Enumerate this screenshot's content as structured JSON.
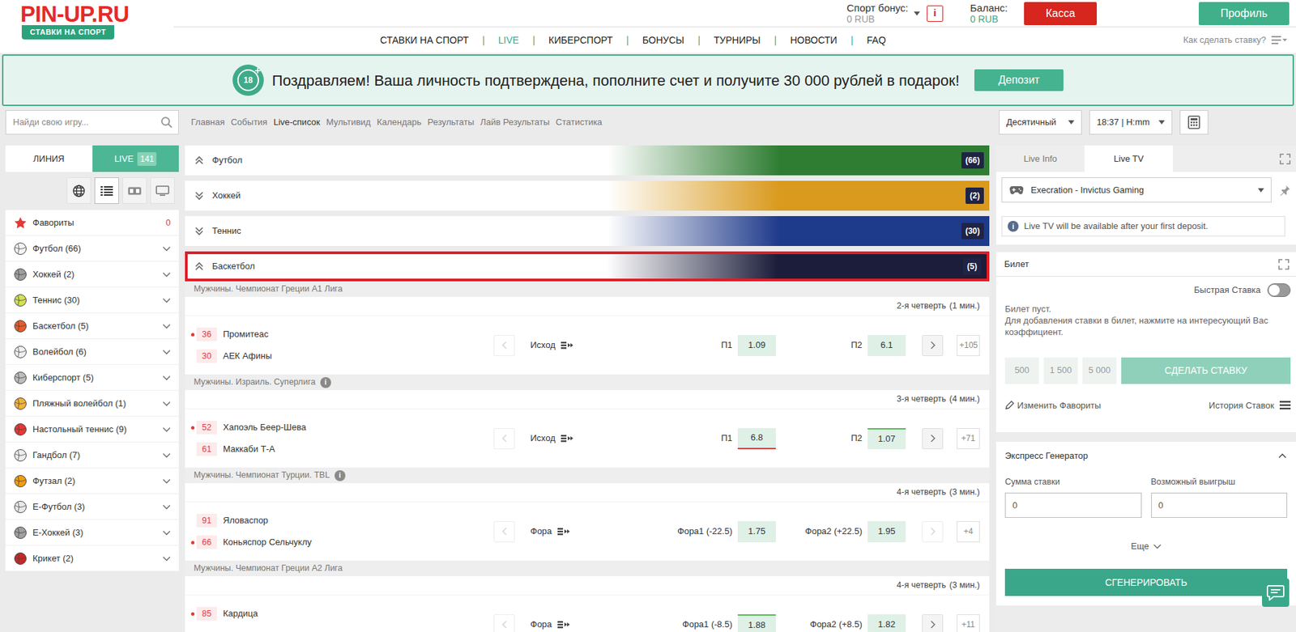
{
  "logo": {
    "brand": "PIN-UP.RU",
    "tagline": "СТАВКИ НА СПОРТ"
  },
  "account": {
    "bonus_label": "Спорт бонус:",
    "bonus_value": "0 RUB",
    "info_icon": "i",
    "balance_label": "Баланс:",
    "balance_value": "0 RUB",
    "cashier_button": "Касса",
    "profile_button": "Профиль"
  },
  "nav_separator": "|",
  "nav": [
    {
      "label": "СТАВКИ НА СПОРТ",
      "selected": false
    },
    {
      "label": "LIVE",
      "selected": true
    },
    {
      "label": "КИБЕРСПОРТ",
      "selected": false
    },
    {
      "label": "БОНУСЫ",
      "selected": false
    },
    {
      "label": "ТУРНИРЫ",
      "selected": false
    },
    {
      "label": "НОВОСТИ",
      "selected": false
    },
    {
      "label": "FAQ",
      "selected": false
    }
  ],
  "help": {
    "label": "Как сделать ставку?"
  },
  "banner": {
    "badge": "18",
    "text": "Поздравляем! Ваша личность подтверждена, пополните счет и получите 30 000 рублей в подарок!",
    "button": "Депозит"
  },
  "search": {
    "placeholder": "Найди свою игру..."
  },
  "breadcrumbs": [
    {
      "label": "Главная",
      "selected": false
    },
    {
      "label": "События",
      "selected": false
    },
    {
      "label": "Live-список",
      "selected": true
    },
    {
      "label": "Мультивид",
      "selected": false
    },
    {
      "label": "Календарь",
      "selected": false
    },
    {
      "label": "Результаты",
      "selected": false
    },
    {
      "label": "Лайв Результаты",
      "selected": false
    },
    {
      "label": "Статистика",
      "selected": false
    }
  ],
  "odds_format": "Десятичный",
  "time_format": "18:37 | H:mm",
  "sidebar": {
    "tabs": [
      {
        "label": "ЛИНИЯ",
        "selected": false
      },
      {
        "label": "LIVE",
        "count": "141",
        "selected": true
      }
    ],
    "views": [
      {
        "kind": "globe",
        "selected": false
      },
      {
        "kind": "list",
        "selected": true
      },
      {
        "kind": "scoreboard",
        "selected": false
      },
      {
        "kind": "tv",
        "selected": false
      }
    ],
    "items": [
      {
        "label": "Фавориты",
        "count": "0",
        "kind": "star",
        "color": "#e53935"
      },
      {
        "label": "Футбол (66)",
        "kind": "ball",
        "color": "#f5f5f5"
      },
      {
        "label": "Хоккей (2)",
        "kind": "ball",
        "color": "#9e9e9e"
      },
      {
        "label": "Теннис (30)",
        "kind": "ball",
        "color": "#d4e157"
      },
      {
        "label": "Баскетбол (5)",
        "kind": "ball",
        "color": "#e65c2a"
      },
      {
        "label": "Волейбол (6)",
        "kind": "ball",
        "color": "#f0f0f0"
      },
      {
        "label": "Киберспорт (5)",
        "kind": "ball",
        "color": "#bdbdbd"
      },
      {
        "label": "Пляжный волейбол (1)",
        "kind": "ball",
        "color": "#f2b33d"
      },
      {
        "label": "Настольный теннис (9)",
        "kind": "ball",
        "color": "#e53935"
      },
      {
        "label": "Гандбол (7)",
        "kind": "ball",
        "color": "#eeeeee"
      },
      {
        "label": "Футзал (2)",
        "kind": "ball",
        "color": "#f39c12"
      },
      {
        "label": "Е-Футбол (3)",
        "kind": "ball",
        "color": "#e8e8e8"
      },
      {
        "label": "Е-Хоккей (3)",
        "kind": "ball",
        "color": "#a0a0a0"
      },
      {
        "label": "Крикет (2)",
        "kind": "ball",
        "color": "#c62828"
      }
    ]
  },
  "categories": [
    {
      "label": "Футбол",
      "count": "(66)",
      "expanded": true,
      "selected": false,
      "color": "#2f7d32"
    },
    {
      "label": "Хоккей",
      "count": "(2)",
      "expanded": false,
      "selected": false,
      "color": "#d99a1e"
    },
    {
      "label": "Теннис",
      "count": "(30)",
      "expanded": false,
      "selected": false,
      "color": "#1e3a8a"
    },
    {
      "label": "Баскетбол",
      "count": "(5)",
      "expanded": true,
      "selected": true,
      "color": "#1b1d3a",
      "matches": [
        {
          "league": "Мужчины. Чемпионат Греции А1 Лига",
          "period": "2-я четверть",
          "minute": "(1 мин.)",
          "home": {
            "name": "Промитеас",
            "score": "36",
            "active": true
          },
          "away": {
            "name": "АЕК Афины",
            "score": "30",
            "active": false
          },
          "market": "Исход",
          "prev_disabled": true,
          "next_disabled": false,
          "odds": [
            {
              "label": "П1",
              "value": "1.09",
              "trend": "none"
            },
            {
              "label": "П2",
              "value": "6.1",
              "trend": "none"
            }
          ],
          "more": "+105"
        },
        {
          "league": "Мужчины. Израиль. Суперлига",
          "info_icon": "i",
          "period": "3-я четверть",
          "minute": "(4 мин.)",
          "home": {
            "name": "Хапоэль Беер-Шева",
            "score": "52",
            "active": true
          },
          "away": {
            "name": "Маккаби Т-А",
            "score": "61",
            "active": false
          },
          "market": "Исход",
          "prev_disabled": true,
          "next_disabled": false,
          "odds": [
            {
              "label": "П1",
              "value": "6.8",
              "trend": "down"
            },
            {
              "label": "П2",
              "value": "1.07",
              "trend": "up"
            }
          ],
          "more": "+71"
        },
        {
          "league": "Мужчины. Чемпионат Турции. TBL",
          "info_icon": "i",
          "period": "4-я четверть",
          "minute": "(3 мин.)",
          "home": {
            "name": "Яловаспор",
            "score": "91",
            "active": false
          },
          "away": {
            "name": "Коньяспор Сельчуклу",
            "score": "66",
            "active": true
          },
          "market": "Фора",
          "prev_disabled": true,
          "next_disabled": true,
          "odds": [
            {
              "label": "Фора1 (-22.5)",
              "value": "1.75",
              "trend": "none"
            },
            {
              "label": "Фора2 (+22.5)",
              "value": "1.95",
              "trend": "none"
            }
          ],
          "more": "+4"
        },
        {
          "league": "Мужчины. Чемпионат Греции А2 Лига",
          "period": "4-я четверть",
          "minute": "(3 мин.)",
          "home": {
            "name": "Кардица",
            "score": "85",
            "active": true
          },
          "market": "Фора",
          "prev_disabled": true,
          "next_disabled": false,
          "odds": [
            {
              "label": "Фора1 (-8.5)",
              "value": "1.88",
              "trend": "up"
            },
            {
              "label": "Фора2 (+8.5)",
              "value": "1.82",
              "trend": "none"
            }
          ],
          "more": "+11"
        }
      ]
    }
  ],
  "live_panel": {
    "tabs": [
      {
        "label": "Live Info",
        "selected": false
      },
      {
        "label": "Live TV",
        "selected": true
      }
    ],
    "event": "Execration - Invictus Gaming",
    "info_icon": "i",
    "note": "Live TV will be available after your first deposit."
  },
  "ticket": {
    "title": "Билет",
    "quick_bet_label": "Быстрая Ставка",
    "quick_bet_on": false,
    "empty_title": "Билет пуст.",
    "empty_text": "Для добавления ставки в билет, нажмите на интересующий Вас коэффициент.",
    "amounts": [
      "500",
      "1 500",
      "5 000"
    ],
    "submit": "СДЕЛАТЬ СТАВКУ",
    "submit_disabled": true,
    "edit_favorites": "Изменить Фавориты",
    "history": "История Ставок"
  },
  "express": {
    "title": "Экспресс Генератор",
    "expanded": true,
    "stake_label": "Сумма ставки",
    "stake_value": "0",
    "win_label": "Возможный выигрыш",
    "win_value": "0",
    "more": "Еще",
    "button": "СГЕНЕРИРОВАТЬ"
  }
}
